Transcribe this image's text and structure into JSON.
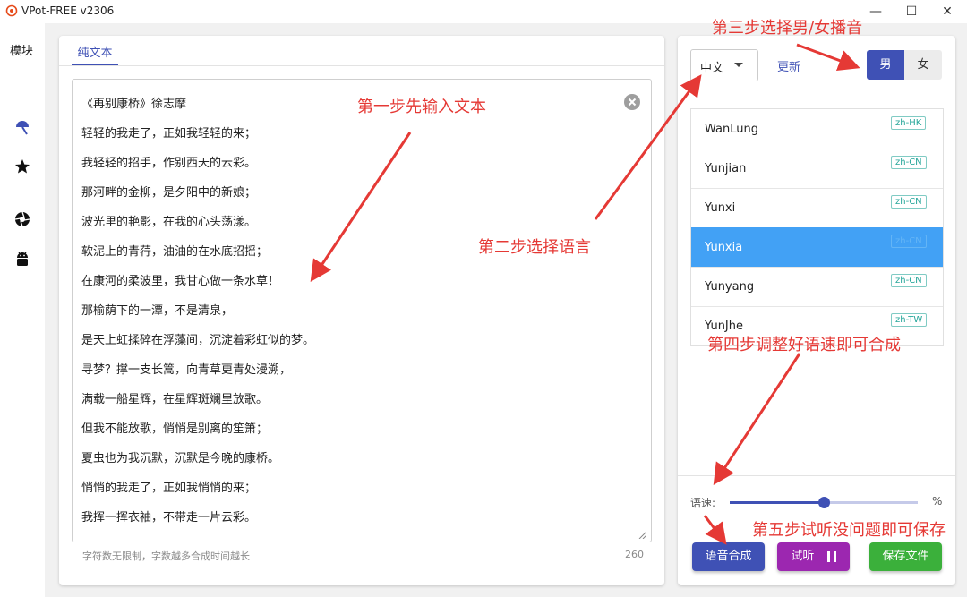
{
  "window": {
    "title": "VPot-FREE v2306",
    "minimize": "—",
    "maximize": "☐",
    "close": "✕"
  },
  "nav": {
    "label": "模块",
    "icons": [
      "umbrella-icon",
      "star-icon",
      "aperture-icon",
      "android-icon"
    ]
  },
  "editor": {
    "tab_label": "纯文本",
    "lines": [
      "《再别康桥》徐志摩",
      "轻轻的我走了，正如我轻轻的来；",
      "我轻轻的招手，作别西天的云彩。",
      "那河畔的金柳，是夕阳中的新娘；",
      "波光里的艳影，在我的心头荡漾。",
      "软泥上的青荇，油油的在水底招摇；",
      "在康河的柔波里，我甘心做一条水草！",
      "那榆荫下的一潭，不是清泉，",
      "是天上虹揉碎在浮藻间，沉淀着彩虹似的梦。",
      "寻梦？撑一支长篙，向青草更青处漫溯，",
      "满载一船星辉，在星辉斑斓里放歌。",
      "但我不能放歌，悄悄是别离的笙箫；",
      "夏虫也为我沉默，沉默是今晚的康桥。",
      "悄悄的我走了，正如我悄悄的来；",
      "我挥一挥衣袖，不带走一片云彩。"
    ],
    "hint": "字符数无限制，字数越多合成时间越长",
    "char_count": "260"
  },
  "settings": {
    "language": "中文",
    "refresh_label": "更新",
    "gender_male": "男",
    "gender_female": "女",
    "selected_gender": "男",
    "voices": [
      {
        "name": "WanLung",
        "locale": "zh-HK"
      },
      {
        "name": "Yunjian",
        "locale": "zh-CN"
      },
      {
        "name": "Yunxi",
        "locale": "zh-CN"
      },
      {
        "name": "Yunxia",
        "locale": "zh-CN",
        "selected": true
      },
      {
        "name": "Yunyang",
        "locale": "zh-CN"
      },
      {
        "name": "YunJhe",
        "locale": "zh-TW"
      }
    ],
    "speed_label": "语速:",
    "speed_value": 0.5,
    "percent_sign": "%",
    "synth_button": "语音合成",
    "preview_button": "试听",
    "save_button": "保存文件"
  },
  "annotations": {
    "step1": "第一步先输入文本",
    "step2": "第二步选择语言",
    "step3": "第三步选择男/女播音",
    "step4": "第四步调整好语速即可合成",
    "step5": "第五步试听没问题即可保存"
  },
  "colors": {
    "primary": "#3f51b5",
    "preview": "#9c27b0",
    "save": "#3bb03b",
    "selected_row": "#42a1f5",
    "annotation": "#e53935"
  }
}
